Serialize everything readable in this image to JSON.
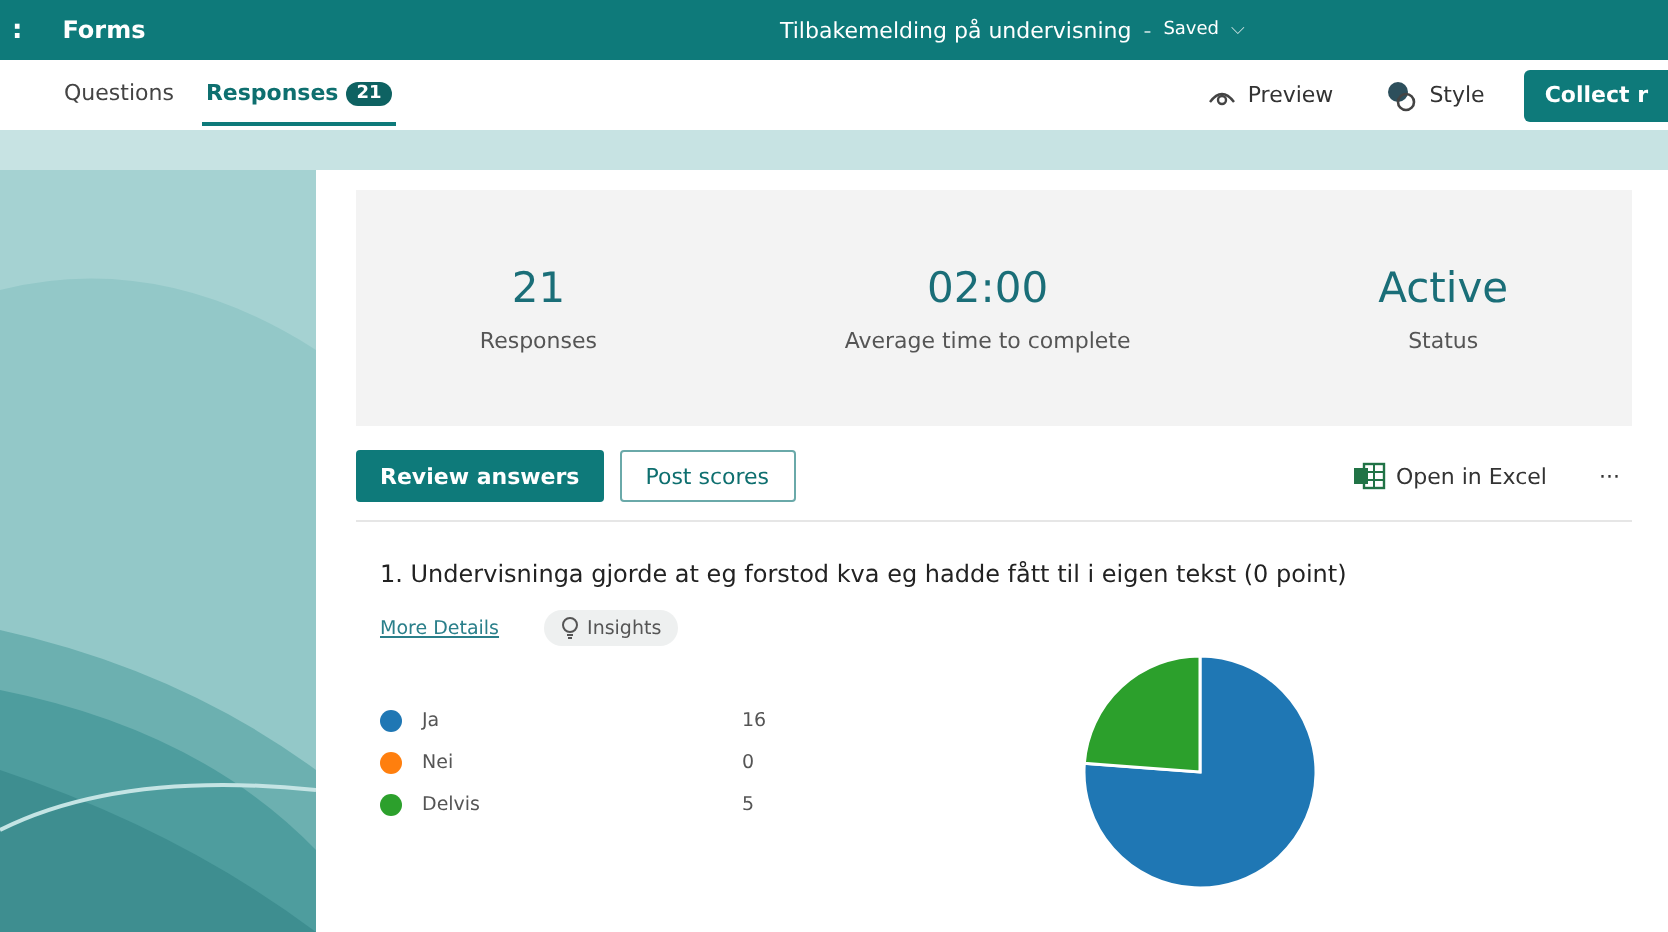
{
  "app_bar": {
    "menu_glyph": ":",
    "app_name": "Forms",
    "form_title": "Tilbakemelding på undervisning",
    "separator": "-",
    "save_state": "Saved",
    "caret": "⌵"
  },
  "tabs": [
    {
      "label": "Questions",
      "selected": false
    },
    {
      "label": "Responses",
      "selected": true,
      "count": "21"
    }
  ],
  "toolbar": {
    "preview": "Preview",
    "style": "Style",
    "collect": "Collect r"
  },
  "summary": [
    {
      "value": "21",
      "label": "Responses"
    },
    {
      "value": "02:00",
      "label": "Average time to complete"
    },
    {
      "value": "Active",
      "label": "Status"
    }
  ],
  "actions": {
    "review": "Review answers",
    "post": "Post scores",
    "excel": "Open in Excel",
    "more": "···"
  },
  "question": {
    "title": "1.  Undervisninga gjorde at eg forstod kva eg hadde fått til i eigen tekst (0 point)",
    "details_link": "More Details",
    "insights": "Insights",
    "legend": [
      {
        "label": "Ja",
        "count": "16",
        "color": "#1f77b4"
      },
      {
        "label": "Nei",
        "count": "0",
        "color": "#ff7f0e"
      },
      {
        "label": "Delvis",
        "count": "5",
        "color": "#2ca02c"
      }
    ],
    "chart_data": {
      "type": "pie",
      "values": [
        76.19,
        0,
        23.81
      ]
    }
  }
}
